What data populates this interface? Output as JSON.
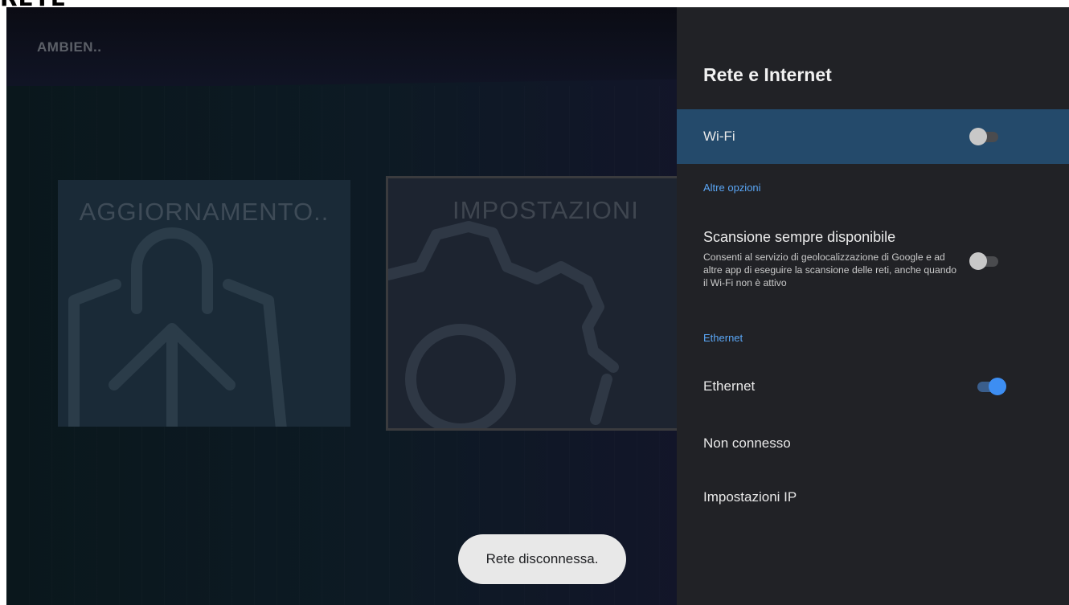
{
  "caption": {
    "text": "RETE"
  },
  "launcher": {
    "title": "AMBIEN..",
    "tiles": [
      {
        "label": "AGGIORNAMENTO.."
      },
      {
        "label": "IMPOSTAZIONI"
      }
    ]
  },
  "panel": {
    "title": "Rete e Internet",
    "wifi": {
      "label": "Wi-Fi",
      "enabled": false
    },
    "more_options": {
      "header": "Altre opzioni",
      "scan": {
        "title": "Scansione sempre disponibile",
        "description": "Consenti al servizio di geolocalizzazione di Google e ad altre app di eseguire la scansione delle reti, anche quando il Wi-Fi non è attivo",
        "enabled": false
      }
    },
    "ethernet_section": {
      "header": "Ethernet",
      "ethernet": {
        "label": "Ethernet",
        "enabled": true
      },
      "status": "Non connesso",
      "ip_settings": "Impostazioni IP"
    }
  },
  "toast": {
    "text": "Rete disconnessa."
  },
  "colors": {
    "accent": "#5aa6f5",
    "selected_row": "#244a6b",
    "panel_bg": "#212226",
    "toggle_on": "#3d8ef2"
  }
}
